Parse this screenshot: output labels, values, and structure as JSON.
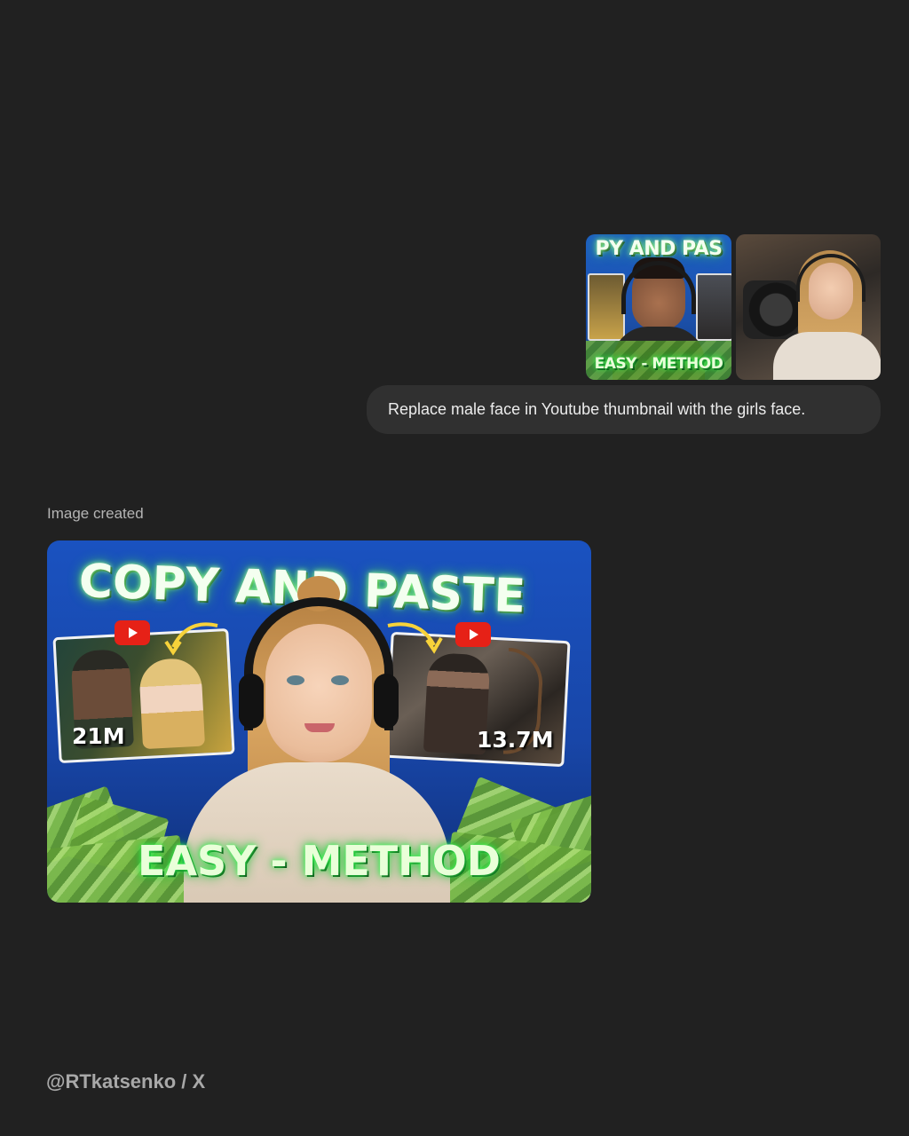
{
  "attachments": {
    "thumbnail": {
      "title_text": "PY AND PAS",
      "bottom_text": "EASY - METHOD"
    }
  },
  "message": {
    "text": "Replace male face in Youtube thumbnail with the girls face."
  },
  "result": {
    "status_label": "Image created",
    "headline": "COPY AND PASTE",
    "left_views": "21M",
    "right_views": "13.7M",
    "bottom_text": "EASY - METHOD"
  },
  "footer": {
    "credit": "@RTkatsenko / X"
  },
  "colors": {
    "background": "#212121",
    "bubble": "#303030",
    "thumb_blue": "#1a52c0",
    "glow_green": "#3dff5a"
  },
  "icons": [
    "youtube-play-icon",
    "arrow-curve-icon",
    "headphones"
  ]
}
